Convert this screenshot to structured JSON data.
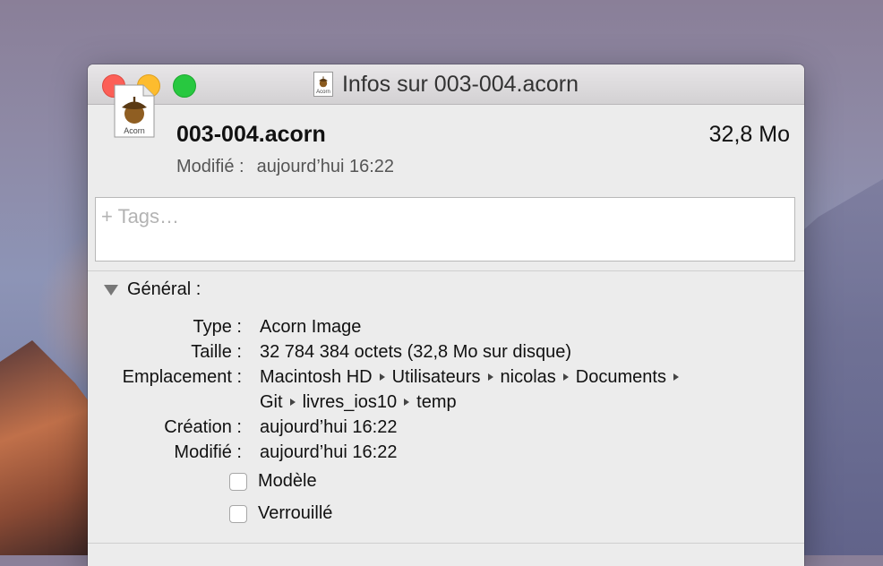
{
  "window": {
    "title": "Infos sur 003-004.acorn",
    "mini_icon_label": "Acorn"
  },
  "file": {
    "name": "003-004.acorn",
    "size": "32,8 Mo",
    "modified_label": "Modifié :",
    "modified_value": "aujourd’hui 16:22",
    "icon_label": "Acorn"
  },
  "tags": {
    "placeholder": "+ Tags…"
  },
  "general": {
    "heading": "Général :",
    "rows": [
      {
        "label": "Type :",
        "value": "Acorn Image"
      },
      {
        "label": "Taille :",
        "value": "32 784 384 octets (32,8 Mo sur disque)"
      },
      {
        "label": "Création :",
        "value": "aujourd’hui 16:22"
      },
      {
        "label": "Modifié :",
        "value": "aujourd’hui 16:22"
      }
    ],
    "location_label": "Emplacement :",
    "location_path": [
      "Macintosh HD",
      "Utilisateurs",
      "nicolas",
      "Documents",
      "Git",
      "livres_ios10",
      "temp"
    ],
    "checkboxes": [
      {
        "label": "Modèle",
        "checked": false
      },
      {
        "label": "Verrouillé",
        "checked": false
      }
    ]
  },
  "colors": {
    "close": "#fc5f57",
    "minimize": "#fdbc2e",
    "maximize": "#28c840"
  }
}
